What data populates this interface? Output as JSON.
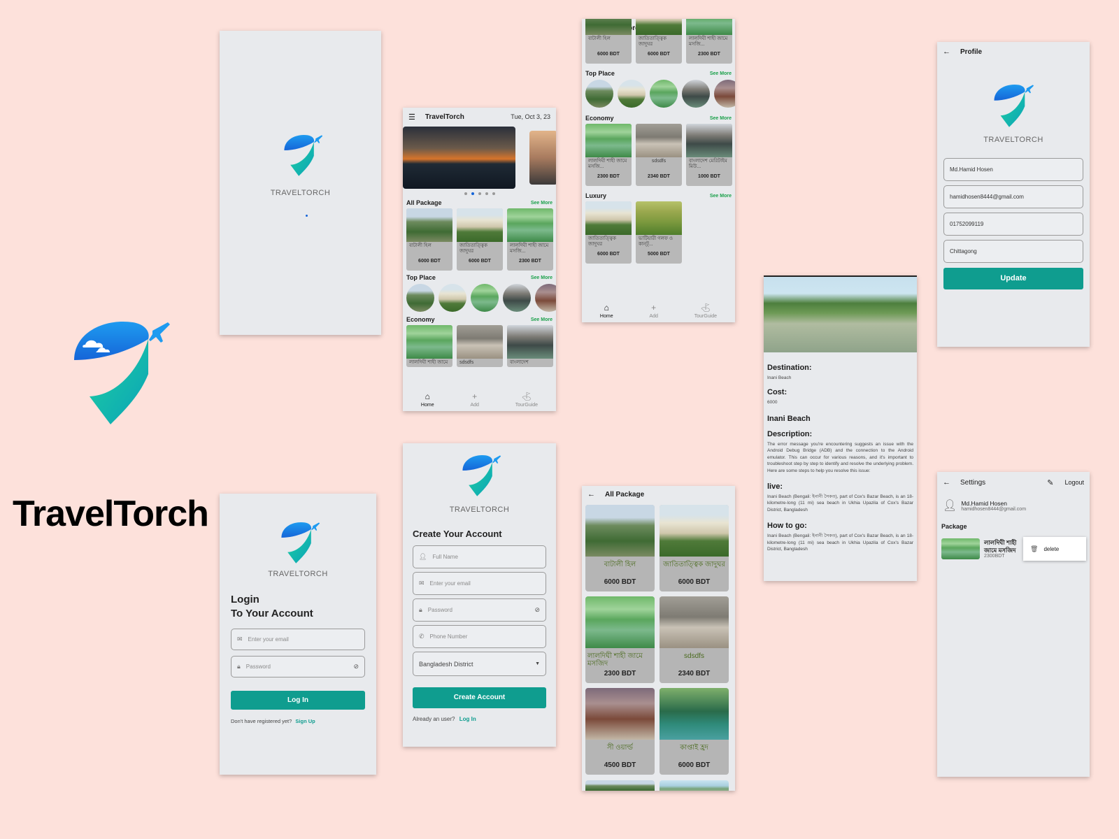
{
  "app": {
    "name": "TravelTorch",
    "brand": "TRAVELTORCH"
  },
  "colors": {
    "accent": "#0f9d8f",
    "background": "#fde1db",
    "see_more": "#1aa04a"
  },
  "home": {
    "title": "TravelTorch",
    "date": "Tue, Oct 3, 23",
    "see_more": "See More",
    "sections": {
      "all_package": "All Package",
      "top_place": "Top Place",
      "economy": "Economy",
      "luxury": "Luxury"
    },
    "all_package": [
      {
        "name": "বাটালী হিল",
        "price": "6000 BDT"
      },
      {
        "name": "জাতিতাত্ত্বিক জাদুঘর",
        "price": "6000 BDT"
      },
      {
        "name": "লালদিঘী শাহী জামে মসজি...",
        "price": "2300 BDT"
      }
    ],
    "economy": [
      {
        "name": "লালদিঘী শাহী জামে মসজি...",
        "price": "2300 BDT"
      },
      {
        "name": "sdsdfs",
        "price": "2340 BDT"
      },
      {
        "name": "বাংলাদেশ মেরিটাইম মিউ...",
        "price": "1000 BDT"
      }
    ],
    "luxury": [
      {
        "name": "জাতিতাত্ত্বিক জাদুঘর",
        "price": "6000 BDT"
      },
      {
        "name": "ভাটিয়ারী গলফ ও কান্ট্...",
        "price": "5000 BDT"
      }
    ],
    "economy_partial": [
      "লালদিঘী শাহী জামে",
      "sdsdfs",
      "বাংলাদেশ"
    ],
    "nav": {
      "home": "Home",
      "add": "Add",
      "guide": "TourGuide"
    }
  },
  "login": {
    "heading1": "Login",
    "heading2": "To Your Account",
    "email_ph": "Enter your email",
    "password_ph": "Password",
    "button": "Log In",
    "no_account": "Don't have registered yet?",
    "sign_up": "Sign Up"
  },
  "signup": {
    "heading": "Create Your Account",
    "name_ph": "Full Name",
    "email_ph": "Enter your email",
    "password_ph": "Password",
    "phone_ph": "Phone Number",
    "district": "Bangladesh District",
    "button": "Create Account",
    "have_account": "Already an user?",
    "log_in": "Log In"
  },
  "all_package_page": {
    "title": "All Package",
    "items": [
      {
        "name": "বাটালী হিল",
        "price": "6000 BDT"
      },
      {
        "name": "জাতিতাত্ত্বিক জাদুঘর",
        "price": "6000 BDT"
      },
      {
        "name": "লালদিঘী শাহী জামে মসজিদ",
        "price": "2300 BDT"
      },
      {
        "name": "sdsdfs",
        "price": "2340 BDT"
      },
      {
        "name": "সী ওয়ার্ল্ড",
        "price": "4500 BDT"
      },
      {
        "name": "কাপ্তাই হ্রদ",
        "price": "6000 BDT"
      }
    ]
  },
  "detail": {
    "destination_label": "Destination:",
    "destination": "Inani Beach",
    "cost_label": "Cost:",
    "cost": "6000",
    "name": "Inani Beach",
    "description_label": "Description:",
    "description": "The error message you're encountering suggests an issue with the Android Debug Bridge (ADB) and the connection to the Android emulator. This can occur for various reasons, and it's important to troubleshoot step by step to identify and resolve the underlying problem. Here are some steps to help you resolve this issue:",
    "live_label": "live:",
    "live": "Inani Beach (Bengali: ইনানী সৈকত), part of Cox's Bazar Beach, is an 18-kilometre-long (11 mi) sea beach in Ukhia Upazila of Cox's Bazar District, Bangladesh",
    "howto_label": "How to go:",
    "howto": "Inani Beach (Bengali: ইনানী সৈকত), part of Cox's Bazar Beach, is an 18-kilometre-long (11 mi) sea beach in Ukhia Upazila of Cox's Bazar District, Bangladesh"
  },
  "profile": {
    "title": "Profile",
    "name": "Md.Hamid Hosen",
    "email": "hamidhosen8444@gmail.com",
    "phone": "01752099119",
    "city": "Chittagong",
    "button": "Update"
  },
  "settings": {
    "title": "Settings",
    "logout": "Logout",
    "user_name": "Md.Hamid Hosen",
    "user_email": "hamidhosen8444@gmail.com",
    "package_label": "Package",
    "pkg_name": "লালদিঘী শাহী জামে মসজিদ",
    "pkg_price": "2300BDT",
    "delete": "delete"
  }
}
